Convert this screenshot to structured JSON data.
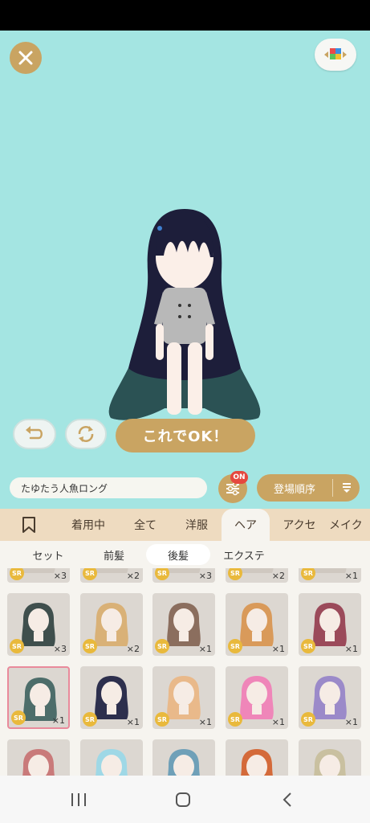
{
  "stage": {
    "ok_label": "これでOK！"
  },
  "toolbar": {
    "item_name": "たゆたう人魚ロング",
    "filter_badge": "ON",
    "sort_label": "登場順序"
  },
  "tabs": [
    "着用中",
    "全て",
    "洋服",
    "ヘア",
    "アクセ",
    "メイク"
  ],
  "active_tab": "ヘア",
  "subtabs": [
    "セット",
    "前髪",
    "後髪",
    "エクステ"
  ],
  "active_subtab": "後髪",
  "grid": {
    "rows": [
      {
        "items": [
          {
            "badge": "SR",
            "count": "×3"
          },
          {
            "badge": "SR",
            "count": "×2"
          },
          {
            "badge": "SR",
            "count": "×3"
          },
          {
            "badge": "SR",
            "count": "×2"
          },
          {
            "badge": "SR",
            "count": "×1"
          }
        ]
      },
      {
        "items": [
          {
            "badge": "SR",
            "count": "×3",
            "hair": "#3f4f4d"
          },
          {
            "badge": "SR",
            "count": "×2",
            "hair": "#d9b177"
          },
          {
            "badge": "SR",
            "count": "×1",
            "hair": "#8b6e5e"
          },
          {
            "badge": "SR",
            "count": "×1",
            "hair": "#d99a5a"
          },
          {
            "badge": "SR",
            "count": "×1",
            "hair": "#9b4a5a"
          }
        ]
      },
      {
        "items": [
          {
            "badge": "SR",
            "count": "×1",
            "hair": "#4d6d6a",
            "selected": true
          },
          {
            "badge": "SR",
            "count": "×1",
            "hair": "#2d2f4d"
          },
          {
            "badge": "SR",
            "count": "×1",
            "hair": "#e9b98a"
          },
          {
            "badge": "SR",
            "count": "×1",
            "hair": "#ef86b9"
          },
          {
            "badge": "SR",
            "count": "×1",
            "hair": "#9b8ac9"
          }
        ]
      },
      {
        "items": [
          {
            "hair": "#c97a7a"
          },
          {
            "hair": "#9fd8e6"
          },
          {
            "hair": "#6fa0b8"
          },
          {
            "hair": "#d46a3a"
          },
          {
            "hair": "#c9c0a0"
          }
        ]
      }
    ]
  },
  "colors": {
    "accent": "#c9a462",
    "stage_bg": "#a4e5e2",
    "tab_bg": "#eedbc0"
  }
}
